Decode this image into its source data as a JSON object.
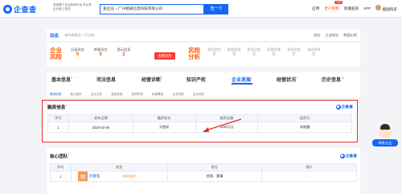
{
  "header": {
    "logo_text": "企查查",
    "slogan": "查查看下企业查询平台 专业查企业就上查查",
    "search_scope": "查企业",
    "search_value": "广州相通信息科技有限公司",
    "search_button": "查一下",
    "nav": [
      "应用",
      "老户用我",
      "到期查询",
      "APP",
      "截图购买"
    ],
    "vip_badge": "VIP"
  },
  "dynamic": {
    "label": "动态",
    "text": "来的查看会一手动态",
    "actions": [
      "网站",
      "企业地址",
      "数据纠错"
    ]
  },
  "risk": {
    "title": "企业风险",
    "stats": [
      {
        "k": "自身风险",
        "v": "0"
      },
      {
        "k": "关联风险",
        "v": "0"
      },
      {
        "k": "提示信息",
        "v": "2"
      }
    ],
    "button": "查看风险",
    "fx_title": "风险分析",
    "fx_stats": [
      {
        "k": "合同违约",
        "v": "0"
      },
      {
        "k": "股权冻结",
        "v": "0"
      },
      {
        "k": "合作风险",
        "v": "0"
      },
      {
        "k": "经营异常",
        "v": "0"
      },
      {
        "k": "合作风险",
        "v": "0"
      },
      {
        "k": "派诉关系",
        "v": "0"
      }
    ]
  },
  "tabs": [
    {
      "label": "基本信息",
      "count": "5"
    },
    {
      "label": "司法信息",
      "count": ""
    },
    {
      "label": "经营诊断",
      "count": "2"
    },
    {
      "label": "知识产权",
      "count": ""
    },
    {
      "label": "企业发展",
      "count": "2"
    },
    {
      "label": "经营状况",
      "count": "2"
    },
    {
      "label": "历史信息",
      "count": "10"
    }
  ],
  "subtabs": [
    "融资信息",
    "核心团队",
    "企业业务",
    "竞品信息",
    "投资机构",
    "私募基金",
    "企业年报",
    "企业动态"
  ],
  "financing": {
    "title": "融资信息",
    "count": "1",
    "tag": "企查查",
    "columns": [
      "序号",
      "发布日期",
      "融资轮次",
      "融资金额",
      "投资方"
    ],
    "rows": [
      [
        "1",
        "2026-02-09",
        "天使轮",
        "1200万元",
        "未披露"
      ]
    ]
  },
  "team": {
    "title": "核心团队",
    "count": "1",
    "tag": "企查查",
    "columns": [
      "序号",
      "姓名",
      "职位",
      "简介"
    ],
    "rows": [
      {
        "no": "1",
        "avatar": "刘",
        "name": "刘嘉强",
        "tag": "实际控制人",
        "role": "经理、董事",
        "intro": "-"
      }
    ]
  },
  "float_service": {
    "label": "联系企业"
  }
}
